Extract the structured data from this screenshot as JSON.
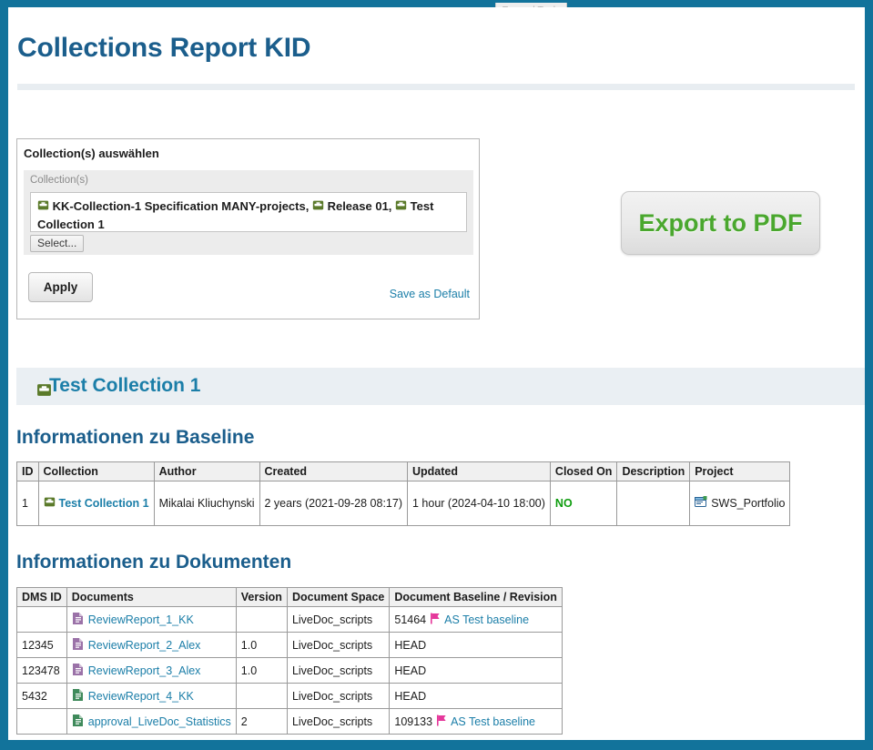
{
  "window": {
    "expand_tools_label": "Expand Tools",
    "frame_color": "#12739b"
  },
  "page": {
    "title": "Collections Report KID"
  },
  "selector": {
    "legend": "Collection(s) auswählen",
    "field_label": "Collection(s)",
    "selected_parts": [
      "KK-Collection-1 Specification MANY-projects,",
      "Release 01,",
      "Test Collection 1"
    ],
    "select_button": "Select...",
    "apply_button": "Apply",
    "save_as_default": "Save as Default"
  },
  "export": {
    "label": "Export to PDF",
    "text_color": "#4aa72e"
  },
  "collection_section": {
    "title": "Test Collection 1",
    "icon": "collection-box-icon"
  },
  "baseline": {
    "heading": "Informationen zu Baseline",
    "columns": [
      "ID",
      "Collection",
      "Author",
      "Created",
      "Updated",
      "Closed On",
      "Description",
      "Project"
    ],
    "rows": [
      {
        "id": "1",
        "collection": "Test Collection 1",
        "collection_icon": "collection-box-icon",
        "author": "Mikalai Kliuchynski",
        "created": "2 years (2021-09-28 08:17)",
        "updated": "1 hour (2024-04-10 18:00)",
        "closed_on": "NO",
        "description": "",
        "project": "SWS_Portfolio",
        "project_icon": "project-window-icon"
      }
    ]
  },
  "documents": {
    "heading": "Informationen zu Dokumenten",
    "columns": [
      "DMS ID",
      "Documents",
      "Version",
      "Document Space",
      "Document Baseline / Revision"
    ],
    "rows": [
      {
        "dms_id": "",
        "document": "ReviewReport_1_KK",
        "doc_icon": "document-purple-icon",
        "version": "",
        "space": "LiveDoc_scripts",
        "revision_number": "51464",
        "revision_flag": "flag-icon",
        "revision_label": "AS Test baseline"
      },
      {
        "dms_id": "12345",
        "document": "ReviewReport_2_Alex",
        "doc_icon": "document-purple-icon",
        "version": "1.0",
        "space": "LiveDoc_scripts",
        "revision_number": "HEAD",
        "revision_flag": "",
        "revision_label": ""
      },
      {
        "dms_id": "123478",
        "document": "ReviewReport_3_Alex",
        "doc_icon": "document-purple-icon",
        "version": "1.0",
        "space": "LiveDoc_scripts",
        "revision_number": "HEAD",
        "revision_flag": "",
        "revision_label": ""
      },
      {
        "dms_id": "5432",
        "document": "ReviewReport_4_KK",
        "doc_icon": "document-green-icon",
        "version": "",
        "space": "LiveDoc_scripts",
        "revision_number": "HEAD",
        "revision_flag": "",
        "revision_label": ""
      },
      {
        "dms_id": "",
        "document": "approval_LiveDoc_Statistics",
        "doc_icon": "document-green-icon",
        "version": "2",
        "space": "LiveDoc_scripts",
        "revision_number": "109133",
        "revision_flag": "flag-icon",
        "revision_label": "AS Test baseline"
      }
    ]
  },
  "colors": {
    "frame": "#12739b",
    "title": "#1b5e8c",
    "link": "#1b7ea8",
    "collection_icon": "#5b7a2a",
    "doc_purple": "#9b72a8",
    "doc_green": "#3f8a5b",
    "flag": "#e5389b",
    "closed_no": "#0f9d0f"
  }
}
